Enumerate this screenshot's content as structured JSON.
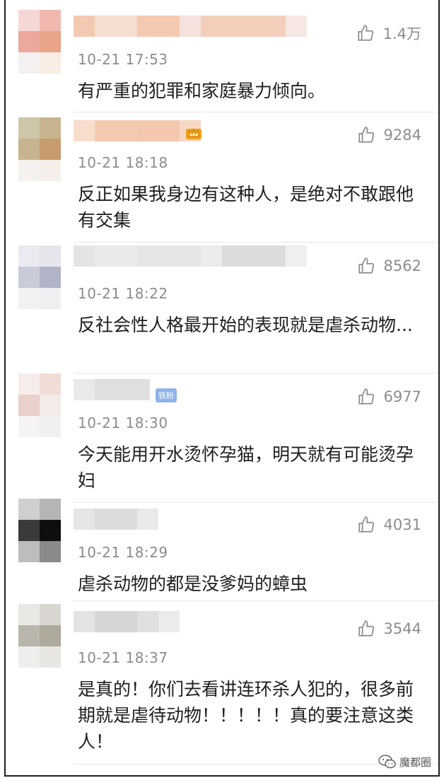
{
  "comments": [
    {
      "time": "10-21 17:53",
      "likes": "1.4万",
      "text": "有严重的犯罪和家庭暴力倾向。",
      "badge": "none"
    },
    {
      "time": "10-21 18:18",
      "likes": "9284",
      "text": "反正如果我身边有这种人，是绝对不敢跟他有交集",
      "badge": "crown-icon"
    },
    {
      "time": "10-21 18:22",
      "likes": "8562",
      "text": "反社会性人格最开始的表现就是虐杀动物...",
      "badge": "none"
    },
    {
      "time": "10-21 18:30",
      "likes": "6977",
      "text": "今天能用开水烫怀孕猫，明天就有可能烫孕妇",
      "badge": "fan",
      "badge_label": "铁粉"
    },
    {
      "time": "10-21 18:29",
      "likes": "4031",
      "text": "虐杀动物的都是没爹妈的蟑虫",
      "badge": "none"
    },
    {
      "time": "10-21 18:37",
      "likes": "3544",
      "text": "是真的！你们去看讲连环杀人犯的，很多前期就是虐待动物！！！！！真的要注意这类人！",
      "badge": "none"
    }
  ],
  "watermark": {
    "label": "魔都圈",
    "icon": "wechat-icon"
  },
  "colors": {
    "time": "#8c8c8c",
    "text": "#1e1e1e",
    "fan_badge": "#8fb3e8"
  }
}
